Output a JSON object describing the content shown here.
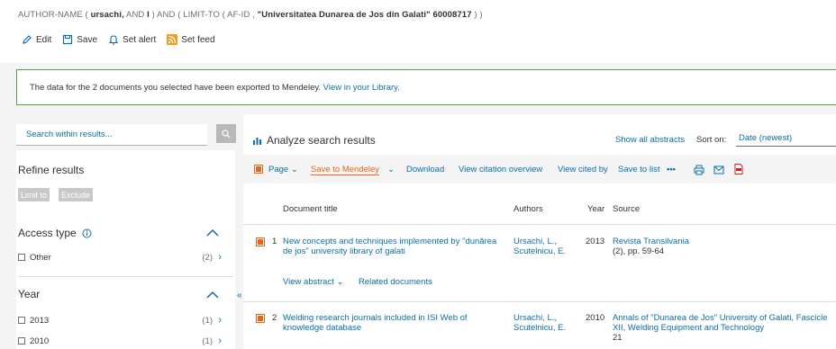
{
  "query": {
    "prefix": "AUTHOR-NAME ( ",
    "author": "ursachi,",
    "mid1": "  AND ",
    "initial": "I",
    "mid2": " )  AND  ( LIMIT-TO ( AF-ID ,  ",
    "affiliation": "\"Universitatea Dunarea de Jos din Galati\"",
    "affid": "  60008717",
    "suffix": " ) )"
  },
  "query_actions": [
    {
      "label": "Edit",
      "icon": "pencil-icon"
    },
    {
      "label": "Save",
      "icon": "save-icon"
    },
    {
      "label": "Set alert",
      "icon": "bell-icon"
    },
    {
      "label": "Set feed",
      "icon": "rss-icon"
    }
  ],
  "notice": {
    "text": "The data for the 2 documents you selected have been exported to Mendeley. ",
    "link": "View in your Library."
  },
  "sidebar": {
    "search_placeholder": "Search within results...",
    "refine_title": "Refine results",
    "limit_label": "Limit to",
    "exclude_label": "Exclude",
    "facets": [
      {
        "title": "Access type",
        "info_icon": "info-icon",
        "rows": [
          {
            "label": "Other",
            "count": "(2)"
          }
        ]
      },
      {
        "title": "Year",
        "rows": [
          {
            "label": "2013",
            "count": "(1)"
          },
          {
            "label": "2010",
            "count": "(1)"
          }
        ]
      }
    ]
  },
  "results": {
    "analyze_label": "Analyze search results",
    "show_abstracts": "Show all abstracts",
    "sort_label": "Sort on:",
    "sort_value": "Date (newest)",
    "toolbar": {
      "page": "Page",
      "save_mendeley": "Save to Mendeley",
      "download": "Download",
      "citation_overview": "View citation overview",
      "cited_by": "View cited by",
      "save_list": "Save to list",
      "more": "•••"
    },
    "columns": [
      "Document title",
      "Authors",
      "Year",
      "Source"
    ],
    "rows": [
      {
        "num": "1",
        "title": "New concepts and techniques implemented by \"dunărea de jos\" university library of galati",
        "authors": "Ursachi, L., Scutelnicu, E.",
        "year": "2013",
        "source": "Revista Transilvania",
        "source_detail": "(2), pp. 59-64",
        "view_abstract": "View abstract",
        "related": "Related documents"
      },
      {
        "num": "2",
        "title": "Welding research journals included in ISI Web of knowledge database",
        "authors": "Ursachi, L., Scutelnicu, E.",
        "year": "2010",
        "source": "Annals of \"Dunarea de Jos\" University of Galati, Fascicle XII, Welding Equipment and Technology",
        "source_detail": "21"
      }
    ]
  },
  "colors": {
    "link": "#0a6ea8",
    "accent": "#e2671c",
    "notice_border": "#5aa03c"
  }
}
